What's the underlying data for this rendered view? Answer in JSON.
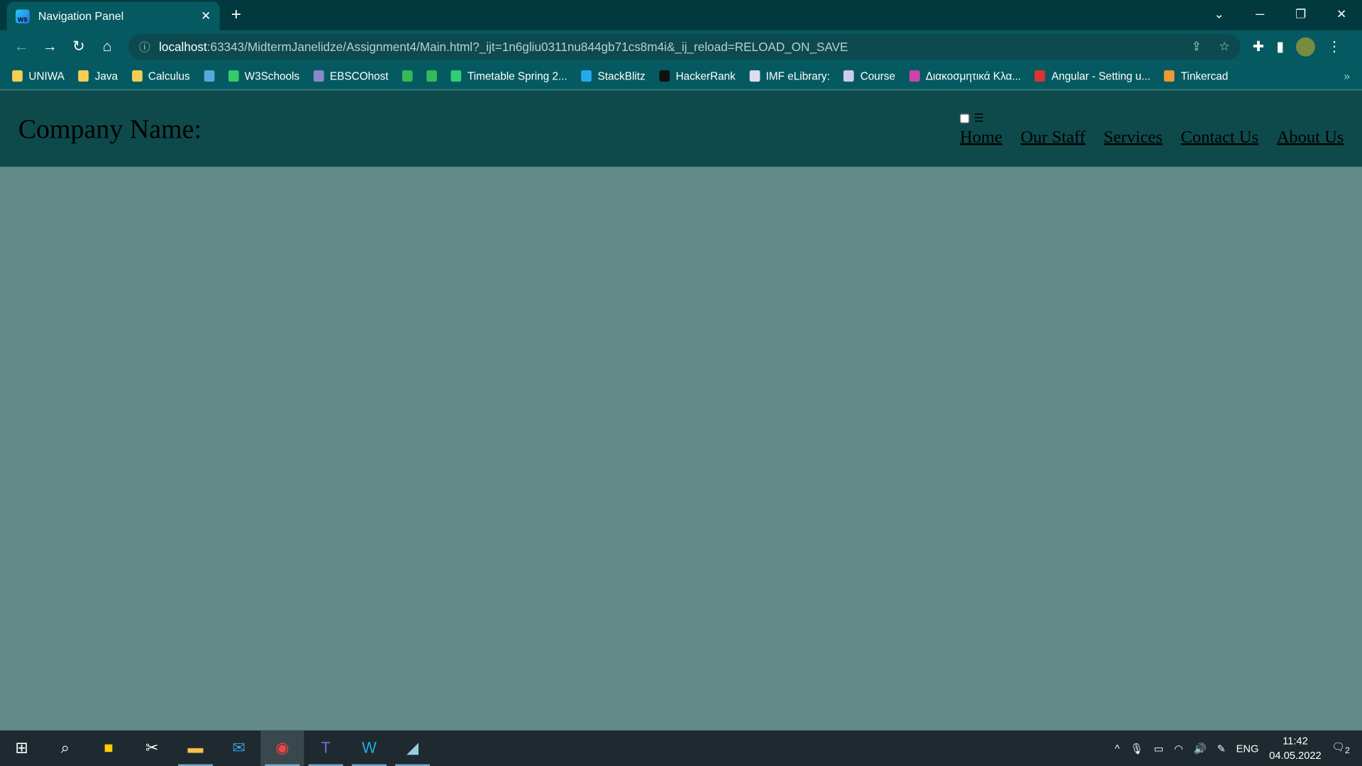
{
  "browser": {
    "tab_title": "Navigation Panel",
    "url_host": "localhost",
    "url_rest": ":63343/MidtermJanelidze/Assignment4/Main.html?_ijt=1n6gliu0311nu844gb71cs8m4i&_ij_reload=RELOAD_ON_SAVE",
    "bookmarks": [
      "UNIWA",
      "Java",
      "Calculus",
      "",
      "W3Schools",
      "EBSCOhost",
      "",
      "",
      "Timetable Spring 2...",
      "StackBlitz",
      "HackerRank",
      "IMF eLibrary:",
      "Course",
      "Διακοσμητικά Κλα...",
      "Angular - Setting u...",
      "Tinkercad"
    ]
  },
  "site": {
    "company": "Company Name:",
    "nav": [
      "Home",
      "Our Staff",
      "Services",
      "Contact Us",
      "About Us"
    ],
    "menu_icon": "☰"
  },
  "taskbar": {
    "lang": "ENG",
    "time": "11:42",
    "date": "04.05.2022",
    "notifications": "2"
  },
  "colors": {
    "header": "#0e4a4c",
    "page": "#648a8a",
    "toolbar": "#045a60"
  }
}
